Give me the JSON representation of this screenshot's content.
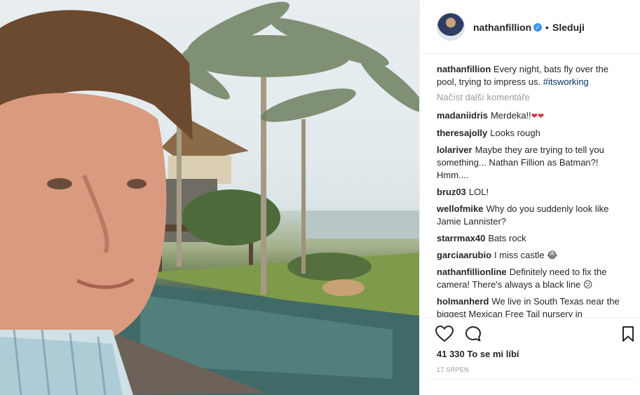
{
  "post": {
    "username": "nathanfillion",
    "verified_mark": "✓",
    "separator": "•",
    "follow_label": "Sleduji"
  },
  "caption": {
    "username": "nathanfillion",
    "text": "Every night, bats fly over the pool, trying to impress us.",
    "hashtag": "#itsworking"
  },
  "load_more": "Načíst další komentáře",
  "comments": [
    {
      "user": "madaniidris",
      "text": "Merdeka!!",
      "emoji": "❤❤"
    },
    {
      "user": "theresajolly",
      "text": "Looks rough"
    },
    {
      "user": "lolariver",
      "text": "Maybe they are trying to tell you something... Nathan Fillion as Batman?! Hmm...."
    },
    {
      "user": "bruz03",
      "text": "LOL!"
    },
    {
      "user": "wellofmike",
      "text": "Why do you suddenly look like Jamie Lannister?"
    },
    {
      "user": "starrmax40",
      "text": "Bats rock"
    },
    {
      "user": "garciaarubio",
      "text": "I miss castle",
      "emoji": "😂"
    },
    {
      "user": "nathanfillionline",
      "text": "Definitely need to fix the camera! There's always a black line",
      "emoji": "😕"
    },
    {
      "user": "holmanherd",
      "text": "We live in South Texas near the biggest Mexican Free Tail nursery in"
    }
  ],
  "likes": "41 330 To se mi líbí",
  "date": "17 SRPEN",
  "icons": {
    "like": "heart-icon",
    "comment": "comment-icon",
    "save": "bookmark-icon",
    "verified": "verified-badge-icon"
  },
  "colors": {
    "verified_blue": "#3897f0",
    "hashtag": "#003569",
    "muted": "#999999",
    "text": "#262626"
  }
}
